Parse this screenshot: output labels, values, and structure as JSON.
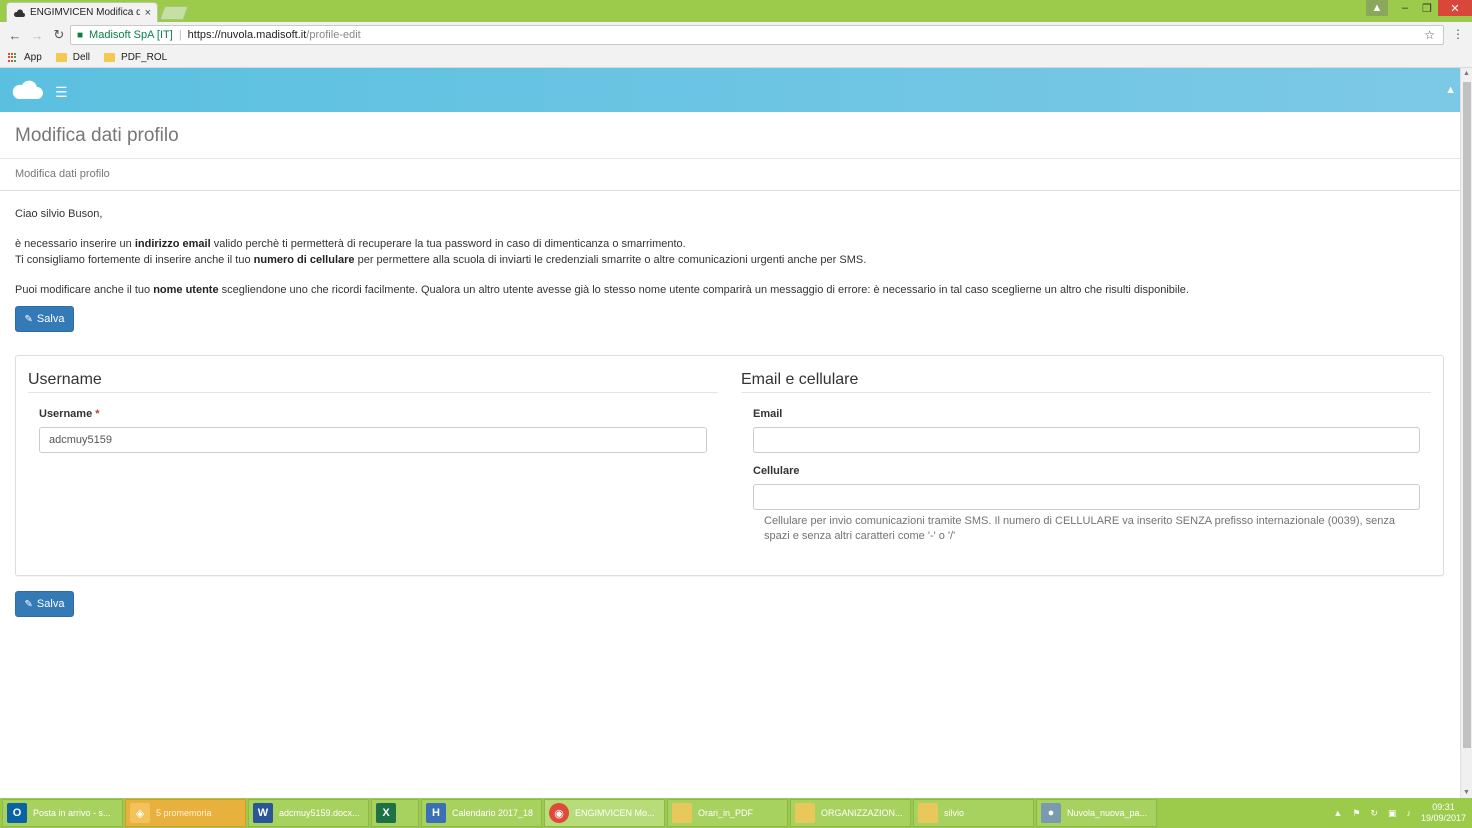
{
  "browser": {
    "tab_title": "ENGIMVICEN Modifica d",
    "tab_close": "×",
    "site_identity": "Madisoft SpA [IT]",
    "url_host": "https://nuvola.madisoft.it",
    "url_path": "/profile-edit",
    "bookmarks": [
      "App",
      "Dell",
      "PDF_ROL"
    ]
  },
  "page": {
    "title": "Modifica dati profilo",
    "breadcrumb": "Modifica dati profilo",
    "greeting": "Ciao silvio Buson,",
    "line1_pre": "è necessario inserire un ",
    "line1_bold": "indirizzo email",
    "line1_post": " valido perchè ti permetterà di recuperare la tua password in caso di dimenticanza o smarrimento.",
    "line2_pre": "Ti consigliamo fortemente di inserire anche il tuo ",
    "line2_bold": "numero di cellulare",
    "line2_post": " per permettere alla scuola di inviarti le credenziali smarrite o altre comunicazioni urgenti anche per SMS.",
    "line3_pre": "Puoi modificare anche il tuo ",
    "line3_bold": "nome utente",
    "line3_post": " scegliendone uno che ricordi facilmente. Qualora un altro utente avesse già lo stesso nome utente comparirà un messaggio di errore: è necessario in tal caso sceglierne un altro che risulti disponibile.",
    "save_label": "Salva"
  },
  "form": {
    "username_section": "Username",
    "username_label": "Username",
    "required_mark": "*",
    "username_value": "adcmuy5159",
    "contact_section": "Email e cellulare",
    "email_label": "Email",
    "email_value": "",
    "cell_label": "Cellulare",
    "cell_value": "",
    "cell_help_1": "Cellulare per invio comunicazioni tramite SMS. Il numero di CELLULARE va inserito SENZA prefisso internazionale (0039), senza",
    "cell_help_2": "spazi e senza altri caratteri come '-' o '/'"
  },
  "taskbar": {
    "items": [
      {
        "label": "Posta in arrivo - s...",
        "icon": "O",
        "color": "#0a64a4"
      },
      {
        "label": "5 promemoria",
        "icon": "",
        "color": "#f3c25a"
      },
      {
        "label": "adcmuy5159.docx...",
        "icon": "W",
        "color": "#2b5797"
      },
      {
        "label": "",
        "icon": "X",
        "color": "#1e7145"
      },
      {
        "label": "Calendario 2017_18",
        "icon": "H",
        "color": "#3b6fb6"
      },
      {
        "label": "ENGIMVICEN Mo...",
        "icon": "",
        "color": "#dd4b39"
      },
      {
        "label": "Orari_in_PDF",
        "icon": "",
        "color": "#e8c85a"
      },
      {
        "label": "ORGANIZZAZION...",
        "icon": "",
        "color": "#e8c85a"
      },
      {
        "label": "silvio",
        "icon": "",
        "color": "#e8c85a"
      },
      {
        "label": "Nuvola_nuova_pa...",
        "icon": "",
        "color": "#7a9ab0"
      }
    ],
    "time": "09:31",
    "date": "19/09/2017"
  }
}
